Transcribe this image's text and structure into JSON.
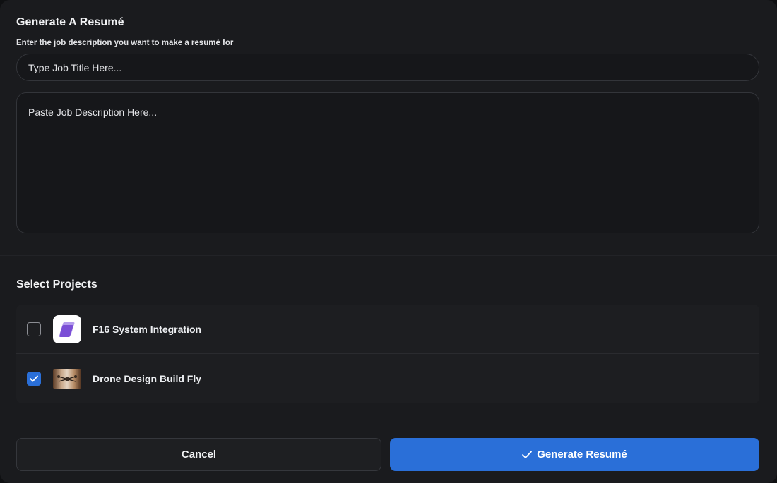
{
  "modal": {
    "title": "Generate A Resumé",
    "subtitle": "Enter the job description you want to make a resumé for"
  },
  "job_title_input": {
    "placeholder": "Type Job Title Here...",
    "value": ""
  },
  "job_description_input": {
    "placeholder": "Paste Job Description Here...",
    "value": ""
  },
  "projects": {
    "title": "Select Projects",
    "items": [
      {
        "name": "F16 System Integration",
        "checked": false,
        "icon": "stacked-layers-logo-icon"
      },
      {
        "name": "Drone Design Build Fly",
        "checked": true,
        "icon": "drone-photo-thumbnail"
      }
    ]
  },
  "actions": {
    "cancel_label": "Cancel",
    "generate_label": "Generate Resumé"
  },
  "colors": {
    "accent": "#2a6fd8",
    "background": "#1a1b1e",
    "logo_purple": "#7b4fd6"
  }
}
